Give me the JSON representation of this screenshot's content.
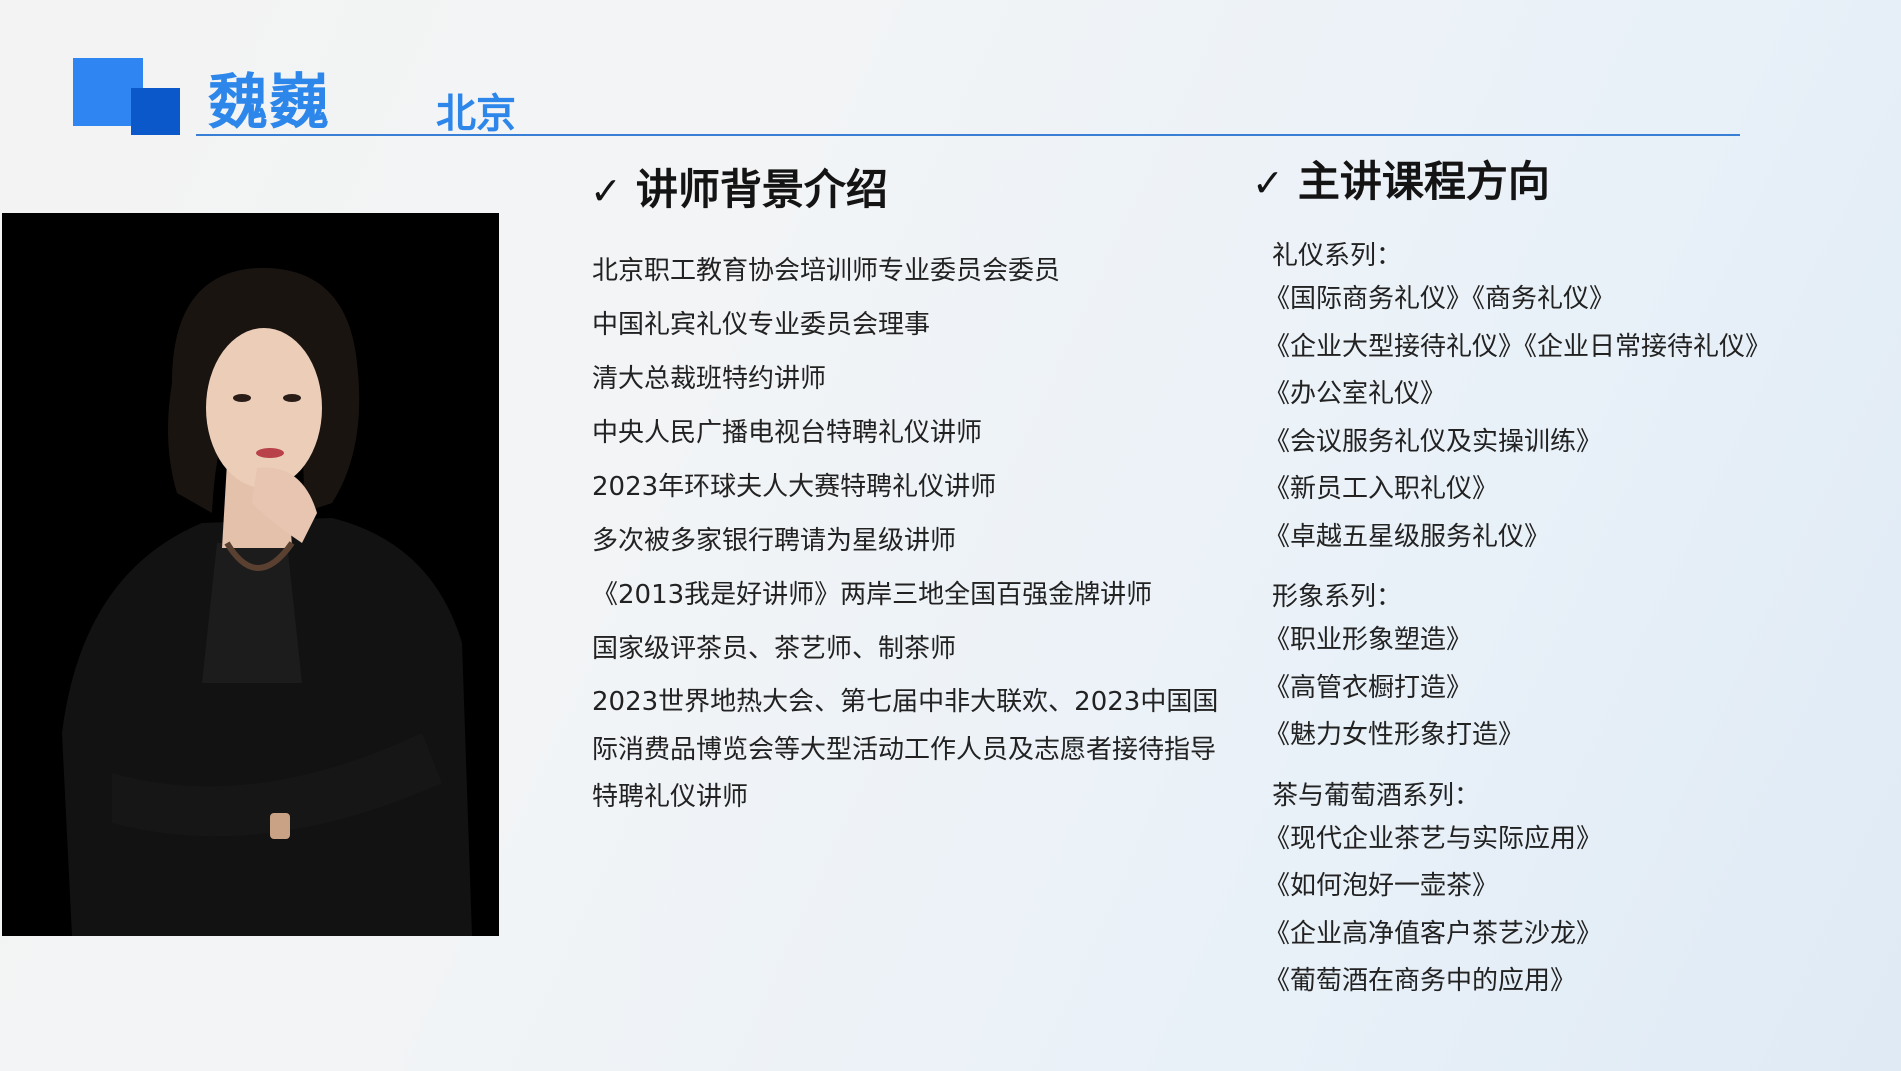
{
  "header": {
    "name": "魏巍",
    "city": "北京"
  },
  "colors": {
    "accent_light": "#2f86f2",
    "accent_dark": "#0a58c9",
    "title_blue": "#2d86ea"
  },
  "background": {
    "check": "✓",
    "title": "讲师背景介绍",
    "items": [
      "北京职工教育协会培训师专业委员会委员",
      "中国礼宾礼仪专业委员会理事",
      "清大总裁班特约讲师",
      "中央人民广播电视台特聘礼仪讲师",
      "2023年环球夫人大赛特聘礼仪讲师",
      "多次被多家银行聘请为星级讲师",
      "《2013我是好讲师》两岸三地全国百强金牌讲师",
      "国家级评茶员、茶艺师、制茶师",
      "2023世界地热大会、第七届中非大联欢、2023中国国际消费品博览会等大型活动工作人员及志愿者接待指导特聘礼仪讲师"
    ]
  },
  "courses": {
    "check": "✓",
    "title": "主讲课程方向",
    "series": [
      {
        "title": "礼仪系列：",
        "items": [
          "《国际商务礼仪》《商务礼仪》",
          "《企业大型接待礼仪》《企业日常接待礼仪》",
          "《办公室礼仪》",
          "《会议服务礼仪及实操训练》",
          "《新员工入职礼仪》",
          "《卓越五星级服务礼仪》"
        ]
      },
      {
        "title": "形象系列：",
        "items": [
          "《职业形象塑造》",
          "《高管衣橱打造》",
          "《魅力女性形象打造》"
        ]
      },
      {
        "title": "茶与葡萄酒系列：",
        "items": [
          "《现代企业茶艺与实际应用》",
          "《如何泡好一壶茶》",
          "《企业高净值客户茶艺沙龙》",
          "《葡萄酒在商务中的应用》"
        ]
      }
    ]
  }
}
